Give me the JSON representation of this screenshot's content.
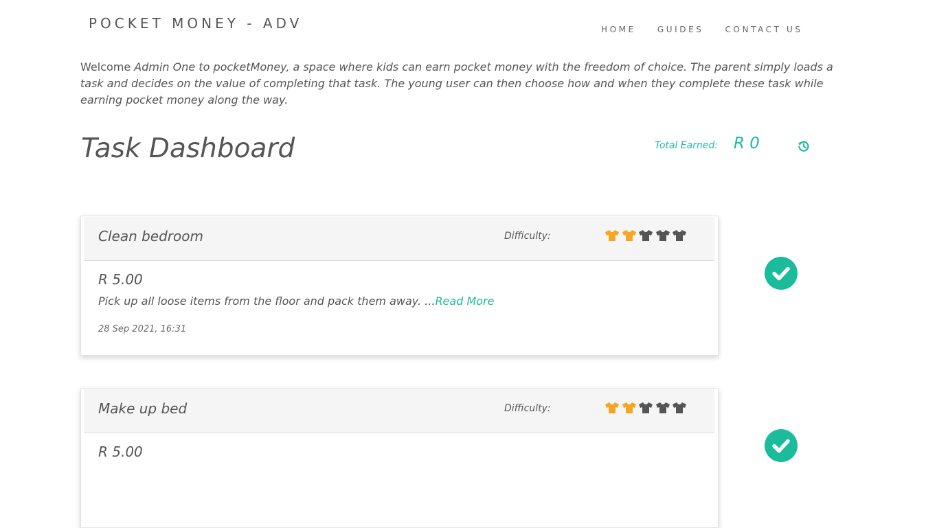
{
  "header": {
    "brand": "POCKET MONEY - ADV",
    "nav": {
      "home": "HOME",
      "guides": "GUIDES",
      "contact": "CONTACT US"
    }
  },
  "intro": {
    "welcome": "Welcome ",
    "rest": "Admin One to pocketMoney, a space where kids can earn pocket money with the freedom of choice. The parent simply loads a task and decides on the value of completing that task. The young user can then choose how and when they complete these task while earning pocket money along the way."
  },
  "dashboard": {
    "title": "Task Dashboard",
    "total_label": "Total Earned:",
    "total_value": "R 0",
    "history_icon": "history-icon"
  },
  "colors": {
    "accent": "#1abc9c",
    "shirt_active": "#f5a623",
    "shirt_inactive": "#555555"
  },
  "tasks": [
    {
      "title": "Clean bedroom",
      "difficulty_label": "Difficulty:",
      "difficulty": 2,
      "difficulty_max": 5,
      "price": "R 5.00",
      "description": "Pick up all loose items from the floor and pack them away. ...",
      "read_more": "Read More",
      "date": "28 Sep 2021, 16:31"
    },
    {
      "title": "Make up bed",
      "difficulty_label": "Difficulty:",
      "difficulty": 2,
      "difficulty_max": 5,
      "price": "R 5.00"
    }
  ]
}
